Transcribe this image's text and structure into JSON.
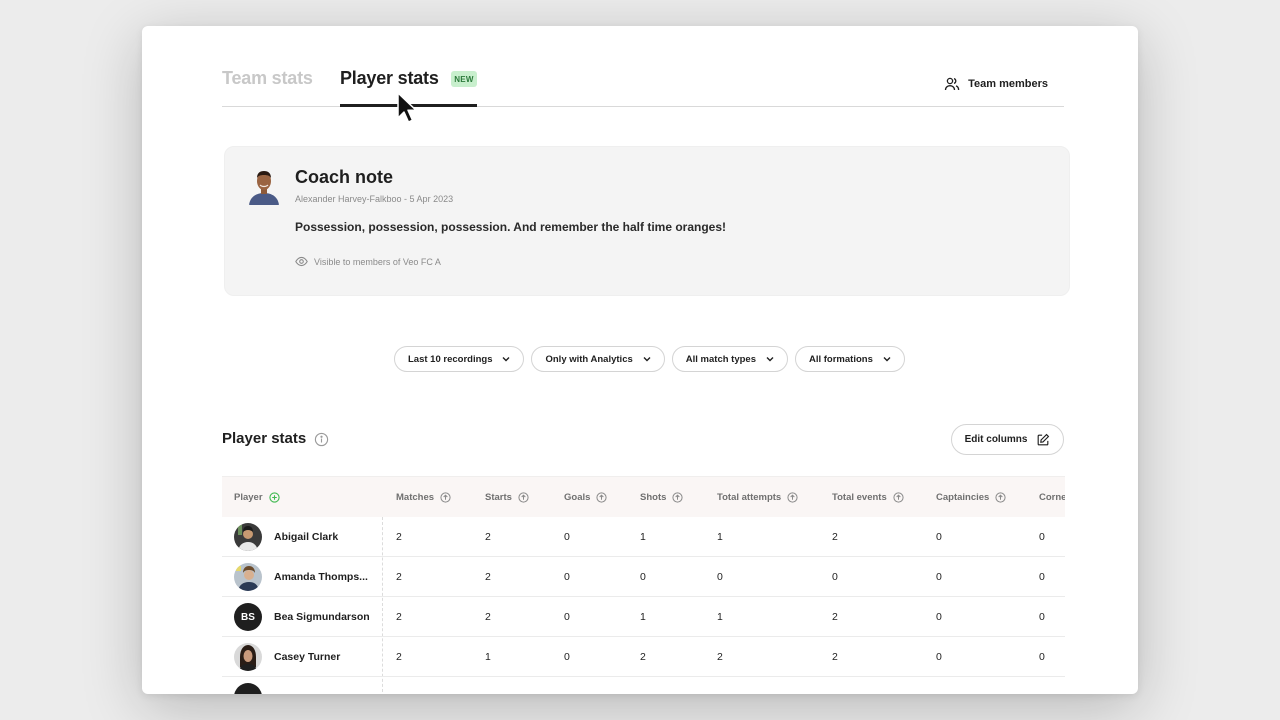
{
  "tabs": {
    "team_stats": "Team stats",
    "player_stats": "Player stats",
    "new_badge": "NEW",
    "team_members": "Team members"
  },
  "coach_note": {
    "title": "Coach note",
    "meta": "Alexander Harvey-Falkboo - 5 Apr 2023",
    "body": "Possession, possession, possession. And remember the half time oranges!",
    "visibility": "Visible to members of Veo FC A"
  },
  "filters": [
    {
      "label": "Last 10 recordings"
    },
    {
      "label": "Only with Analytics"
    },
    {
      "label": "All match types"
    },
    {
      "label": "All formations"
    }
  ],
  "stats": {
    "title": "Player stats",
    "edit_columns": "Edit columns"
  },
  "table": {
    "headers": [
      "Player",
      "Matches",
      "Starts",
      "Goals",
      "Shots",
      "Total attempts",
      "Total events",
      "Captaincies",
      "Corne"
    ],
    "rows": [
      {
        "name": "Abigail Clark",
        "avatar": "photo",
        "values": [
          "2",
          "2",
          "0",
          "1",
          "1",
          "2",
          "0",
          "0"
        ]
      },
      {
        "name": "Amanda Thomps...",
        "avatar": "photo",
        "values": [
          "2",
          "2",
          "0",
          "0",
          "0",
          "0",
          "0",
          "0"
        ]
      },
      {
        "name": "Bea Sigmundarson",
        "avatar": "initials",
        "initials": "BS",
        "values": [
          "2",
          "2",
          "0",
          "1",
          "1",
          "2",
          "0",
          "0"
        ]
      },
      {
        "name": "Casey Turner",
        "avatar": "photo",
        "values": [
          "2",
          "1",
          "0",
          "2",
          "2",
          "2",
          "0",
          "0"
        ]
      }
    ]
  },
  "colors": {
    "accent_green": "#3fb950",
    "badge_bg": "#c8efcd",
    "text": "#1f1f1f",
    "muted": "#8a8a8a"
  }
}
